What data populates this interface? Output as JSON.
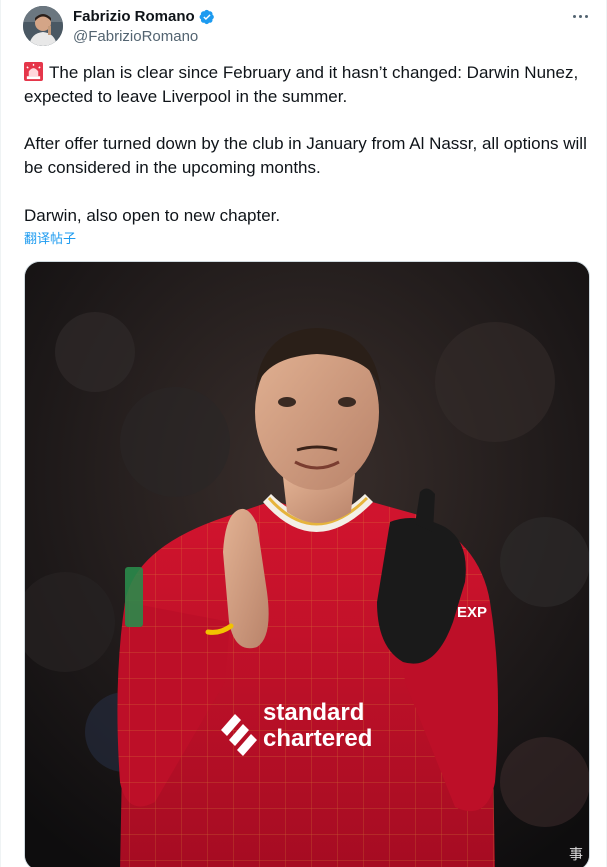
{
  "author": {
    "display_name": "Fabrizio Romano",
    "handle": "@FabrizioRomano",
    "verified": true,
    "avatar_icon": "user-avatar"
  },
  "tweet": {
    "line1": "The plan is clear since February and it hasn’t changed: Darwin Nunez, expected to leave Liverpool in the summer.",
    "line2": "After offer turned down by the club in January from Al Nassr, all options will be considered in the upcoming months.",
    "line3": "Darwin, also open to new chapter.",
    "translate_label": "翻译帖子",
    "lead_icon": "siren-icon"
  },
  "media": {
    "shirt_sponsor_line1": "standard",
    "shirt_sponsor_line2": "chartered",
    "sleeve_text": "EXP",
    "watermark": "事"
  },
  "colors": {
    "accent": "#1d9bf0",
    "text": "#0f1419",
    "secondary": "#536471",
    "jersey": "#c8102e"
  }
}
